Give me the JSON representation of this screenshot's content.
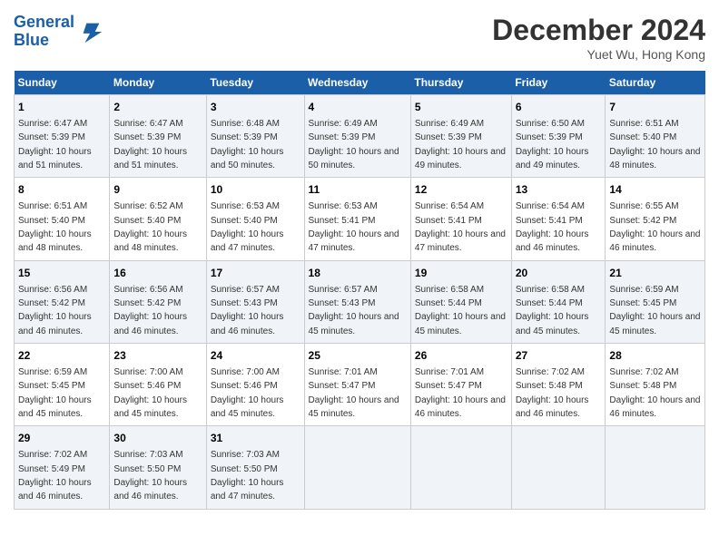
{
  "header": {
    "logo_line1": "General",
    "logo_line2": "Blue",
    "month": "December 2024",
    "location": "Yuet Wu, Hong Kong"
  },
  "days_of_week": [
    "Sunday",
    "Monday",
    "Tuesday",
    "Wednesday",
    "Thursday",
    "Friday",
    "Saturday"
  ],
  "weeks": [
    [
      {
        "day": "1",
        "rise": "6:47 AM",
        "set": "5:39 PM",
        "daylight": "10 hours and 51 minutes."
      },
      {
        "day": "2",
        "rise": "6:47 AM",
        "set": "5:39 PM",
        "daylight": "10 hours and 51 minutes."
      },
      {
        "day": "3",
        "rise": "6:48 AM",
        "set": "5:39 PM",
        "daylight": "10 hours and 50 minutes."
      },
      {
        "day": "4",
        "rise": "6:49 AM",
        "set": "5:39 PM",
        "daylight": "10 hours and 50 minutes."
      },
      {
        "day": "5",
        "rise": "6:49 AM",
        "set": "5:39 PM",
        "daylight": "10 hours and 49 minutes."
      },
      {
        "day": "6",
        "rise": "6:50 AM",
        "set": "5:39 PM",
        "daylight": "10 hours and 49 minutes."
      },
      {
        "day": "7",
        "rise": "6:51 AM",
        "set": "5:40 PM",
        "daylight": "10 hours and 48 minutes."
      }
    ],
    [
      {
        "day": "8",
        "rise": "6:51 AM",
        "set": "5:40 PM",
        "daylight": "10 hours and 48 minutes."
      },
      {
        "day": "9",
        "rise": "6:52 AM",
        "set": "5:40 PM",
        "daylight": "10 hours and 48 minutes."
      },
      {
        "day": "10",
        "rise": "6:53 AM",
        "set": "5:40 PM",
        "daylight": "10 hours and 47 minutes."
      },
      {
        "day": "11",
        "rise": "6:53 AM",
        "set": "5:41 PM",
        "daylight": "10 hours and 47 minutes."
      },
      {
        "day": "12",
        "rise": "6:54 AM",
        "set": "5:41 PM",
        "daylight": "10 hours and 47 minutes."
      },
      {
        "day": "13",
        "rise": "6:54 AM",
        "set": "5:41 PM",
        "daylight": "10 hours and 46 minutes."
      },
      {
        "day": "14",
        "rise": "6:55 AM",
        "set": "5:42 PM",
        "daylight": "10 hours and 46 minutes."
      }
    ],
    [
      {
        "day": "15",
        "rise": "6:56 AM",
        "set": "5:42 PM",
        "daylight": "10 hours and 46 minutes."
      },
      {
        "day": "16",
        "rise": "6:56 AM",
        "set": "5:42 PM",
        "daylight": "10 hours and 46 minutes."
      },
      {
        "day": "17",
        "rise": "6:57 AM",
        "set": "5:43 PM",
        "daylight": "10 hours and 46 minutes."
      },
      {
        "day": "18",
        "rise": "6:57 AM",
        "set": "5:43 PM",
        "daylight": "10 hours and 45 minutes."
      },
      {
        "day": "19",
        "rise": "6:58 AM",
        "set": "5:44 PM",
        "daylight": "10 hours and 45 minutes."
      },
      {
        "day": "20",
        "rise": "6:58 AM",
        "set": "5:44 PM",
        "daylight": "10 hours and 45 minutes."
      },
      {
        "day": "21",
        "rise": "6:59 AM",
        "set": "5:45 PM",
        "daylight": "10 hours and 45 minutes."
      }
    ],
    [
      {
        "day": "22",
        "rise": "6:59 AM",
        "set": "5:45 PM",
        "daylight": "10 hours and 45 minutes."
      },
      {
        "day": "23",
        "rise": "7:00 AM",
        "set": "5:46 PM",
        "daylight": "10 hours and 45 minutes."
      },
      {
        "day": "24",
        "rise": "7:00 AM",
        "set": "5:46 PM",
        "daylight": "10 hours and 45 minutes."
      },
      {
        "day": "25",
        "rise": "7:01 AM",
        "set": "5:47 PM",
        "daylight": "10 hours and 45 minutes."
      },
      {
        "day": "26",
        "rise": "7:01 AM",
        "set": "5:47 PM",
        "daylight": "10 hours and 46 minutes."
      },
      {
        "day": "27",
        "rise": "7:02 AM",
        "set": "5:48 PM",
        "daylight": "10 hours and 46 minutes."
      },
      {
        "day": "28",
        "rise": "7:02 AM",
        "set": "5:48 PM",
        "daylight": "10 hours and 46 minutes."
      }
    ],
    [
      {
        "day": "29",
        "rise": "7:02 AM",
        "set": "5:49 PM",
        "daylight": "10 hours and 46 minutes."
      },
      {
        "day": "30",
        "rise": "7:03 AM",
        "set": "5:50 PM",
        "daylight": "10 hours and 46 minutes."
      },
      {
        "day": "31",
        "rise": "7:03 AM",
        "set": "5:50 PM",
        "daylight": "10 hours and 47 minutes."
      },
      null,
      null,
      null,
      null
    ]
  ]
}
